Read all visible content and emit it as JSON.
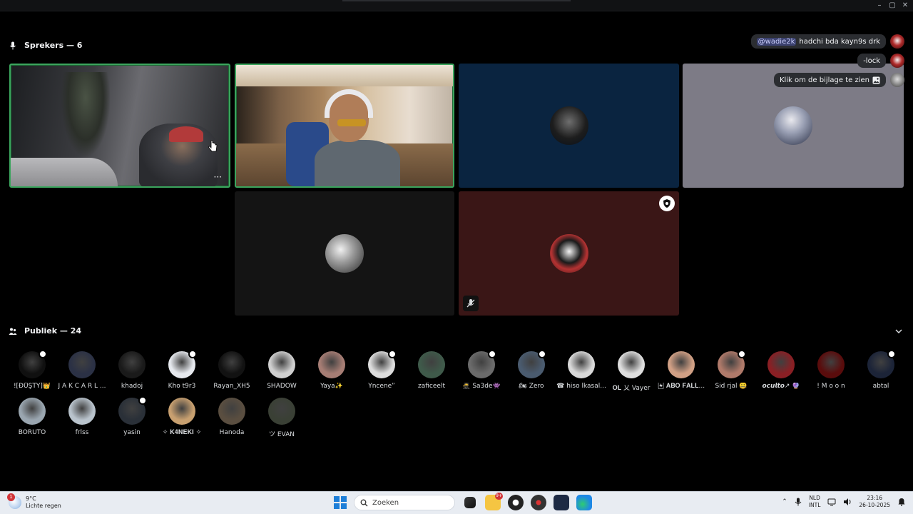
{
  "speakers": {
    "label": "Sprekers — 6"
  },
  "audience_section": {
    "label": "Publiek — 24"
  },
  "chat": [
    {
      "mention": "@wadie2k",
      "text": "hadchi bda kayn9s drk"
    },
    {
      "mention": "",
      "text": "-lock"
    },
    {
      "mention": "",
      "text": "Klik om de bijlage te zien"
    }
  ],
  "tile_more": "···",
  "audience": [
    {
      "name": "![ĐŮŞŤŶ]👑",
      "color": "#101010",
      "badge": true
    },
    {
      "name": "J A K C A R L ...",
      "color": "#2b3145",
      "badge": false
    },
    {
      "name": "khadoj",
      "color": "#1a1a1a",
      "badge": false
    },
    {
      "name": "Kho t9r3",
      "color": "#e6e9ee",
      "badge": true
    },
    {
      "name": "Rayan_XH5",
      "color": "#121212",
      "badge": false
    },
    {
      "name": "SHADOW",
      "color": "#cfcfcf",
      "badge": false
    },
    {
      "name": "Yaya✨",
      "color": "#a67d74",
      "badge": false
    },
    {
      "name": "Ynceneˮ",
      "color": "#dcdcdc",
      "badge": true
    },
    {
      "name": "zaficeelt",
      "color": "#3f5a4a",
      "badge": false
    },
    {
      "name": "🥷 Sa3de👾",
      "color": "#6b6b6b",
      "badge": true
    },
    {
      "name": "🏍 Zero",
      "color": "#4a5b6f",
      "badge": true
    },
    {
      "name": "☎ hiso lkasal...",
      "color": "#d9d9d9",
      "badge": false
    },
    {
      "name": "𝐎𝐋 乂 Vayer",
      "color": "#dedede",
      "badge": false
    },
    {
      "name": "🃏 𝐀𝐁𝐎 𝐅𝐀𝐋𝐋...",
      "color": "#d1a085",
      "badge": false
    },
    {
      "name": "Sid rjal 🤐",
      "color": "#b07a6a",
      "badge": true
    },
    {
      "name": "𝙤𝙘𝙪𝙡𝙩𝙤↗ 🔮",
      "color": "#8a1f24",
      "badge": false
    },
    {
      "name": "! M o o n",
      "color": "#5a0c0c",
      "badge": false
    },
    {
      "name": "abtal",
      "color": "#1c2438",
      "badge": true
    },
    {
      "name": "BORUTO",
      "color": "#9aa6b0",
      "badge": false
    },
    {
      "name": "frlss",
      "color": "#b9c3cc",
      "badge": false
    },
    {
      "name": "yasin",
      "color": "#2a3038",
      "badge": true
    },
    {
      "name": "✧ 𝐊𝟒𝐍𝐄𝐊𝐈 ✧",
      "color": "#c8a070",
      "badge": false
    },
    {
      "name": "Hanoda",
      "color": "#5a4e40",
      "badge": false
    },
    {
      "name": "ツ EVAN",
      "color": "#3a4035",
      "badge": false
    }
  ],
  "taskbar": {
    "weather_badge": "1",
    "temp": "9°C",
    "condition": "Lichte regen",
    "search_placeholder": "Zoeken",
    "notif_badge": "9+",
    "lang_top": "NLD",
    "lang_bottom": "INTL",
    "time": "23:16",
    "date": "26-10-2025"
  },
  "colors": {
    "speaking": "#3ba55d",
    "background": "#000000",
    "chat_bubble": "#2b2d31"
  }
}
